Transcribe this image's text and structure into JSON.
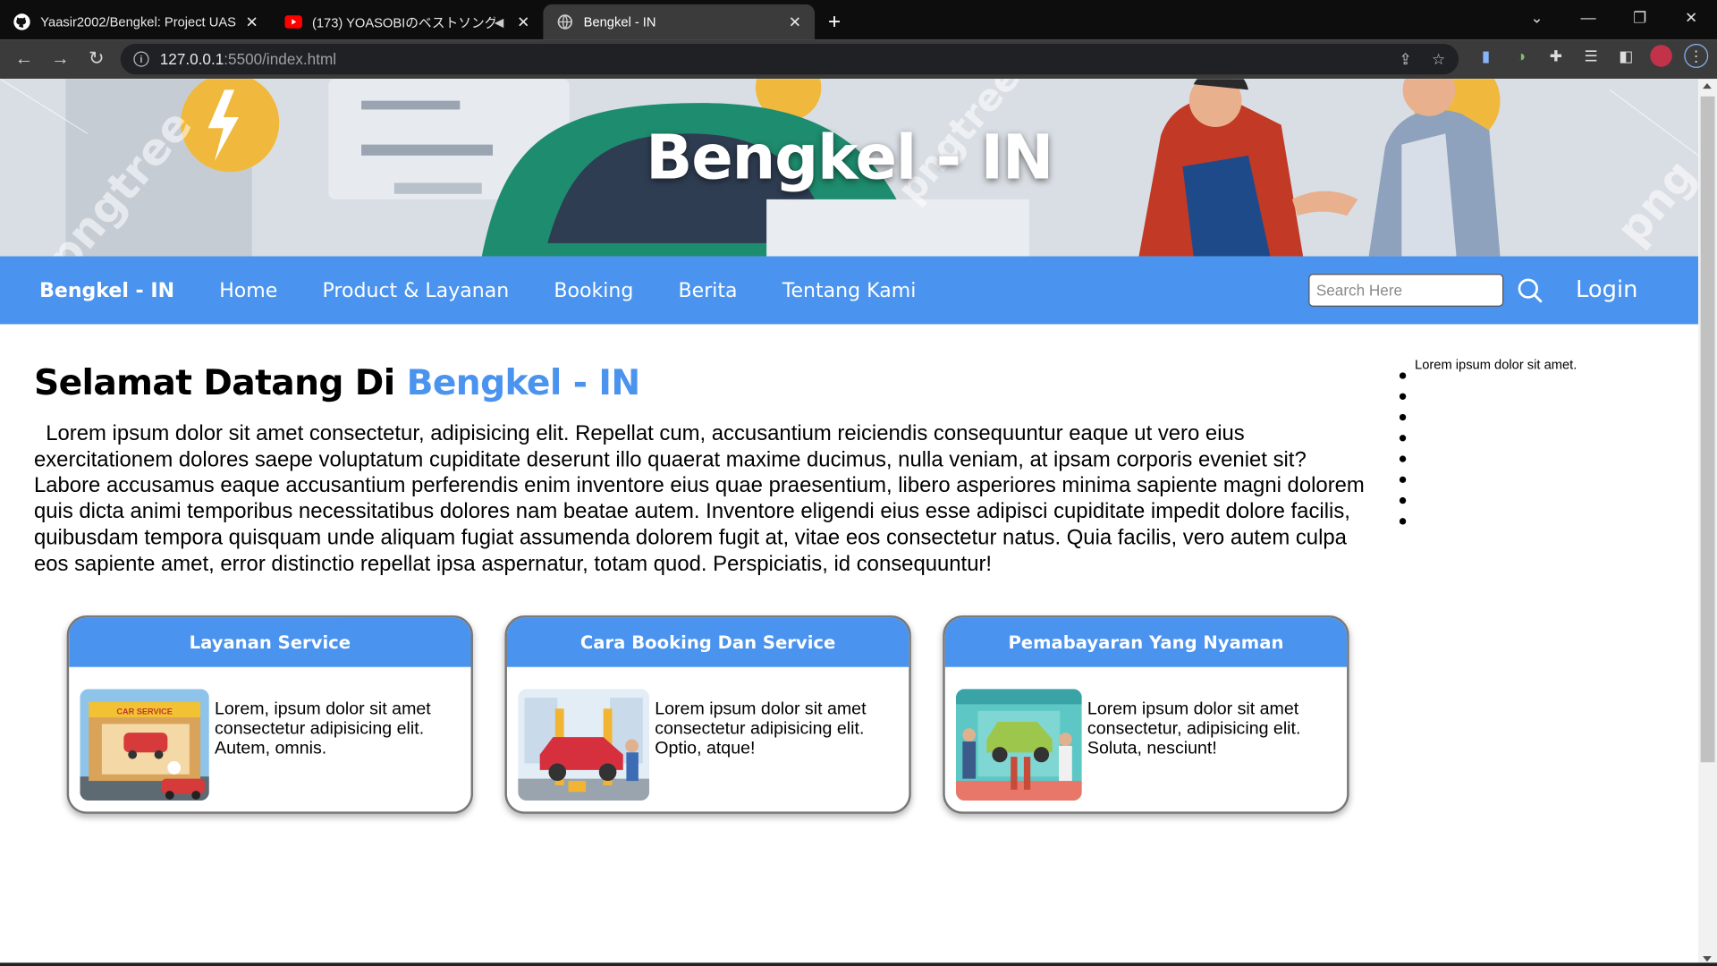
{
  "browser": {
    "tabs": [
      {
        "title": "Yaasir2002/Bengkel: Project UAS",
        "icon": "github-icon"
      },
      {
        "title": "(173) YOASOBIのベストソング -",
        "icon": "youtube-icon"
      },
      {
        "title": "Bengkel - IN",
        "icon": "globe-icon"
      }
    ],
    "url_host": "127.0.0.1",
    "url_rest": ":5500/index.html"
  },
  "hero": {
    "title": "Bengkel - IN"
  },
  "nav": {
    "brand": "Bengkel - IN",
    "links": [
      "Home",
      "Product & Layanan",
      "Booking",
      "Berita",
      "Tentang Kami"
    ],
    "search_placeholder": "Search Here",
    "login": "Login"
  },
  "main": {
    "welcome_prefix": "Selamat Datang Di ",
    "welcome_highlight": "Bengkel - IN",
    "intro": "  Lorem ipsum dolor sit amet consectetur, adipisicing elit. Repellat cum, accusantium reiciendis consequuntur eaque ut vero eius exercitationem dolores saepe voluptatum cupiditate deserunt illo quaerat maxime ducimus, nulla veniam, at ipsam corporis eveniet sit? Labore accusamus eaque accusantium perferendis enim inventore eius quae praesentium, libero asperiores minima sapiente magni dolorem quis dicta animi temporibus necessitatibus dolores nam beatae autem. Inventore eligendi eius esse adipisci cupiditate impedit dolore facilis, quibusdam tempora quisquam unde aliquam fugiat assumenda dolorem fugit at, vitae eos consectetur natus. Quia facilis, vero autem culpa eos sapiente amet, error distinctio repellat ipsa aspernatur, totam quod. Perspiciatis, id consequuntur!"
  },
  "aside": {
    "text": "Lorem ipsum dolor sit amet.",
    "bullet_count": 8
  },
  "cards": [
    {
      "title": "Layanan Service",
      "text": "Lorem, ipsum dolor sit amet consectetur adipisicing elit. Autem, omnis.",
      "image_label": "CAR SERVICE"
    },
    {
      "title": "Cara Booking Dan Service",
      "text": "Lorem ipsum dolor sit amet consectetur adipisicing elit. Optio, atque!"
    },
    {
      "title": "Pemabayaran Yang Nyaman",
      "text": "Lorem ipsum dolor sit amet consectetur, adipisicing elit. Soluta, nesciunt!"
    }
  ],
  "colors": {
    "accent": "#4a93ee"
  }
}
